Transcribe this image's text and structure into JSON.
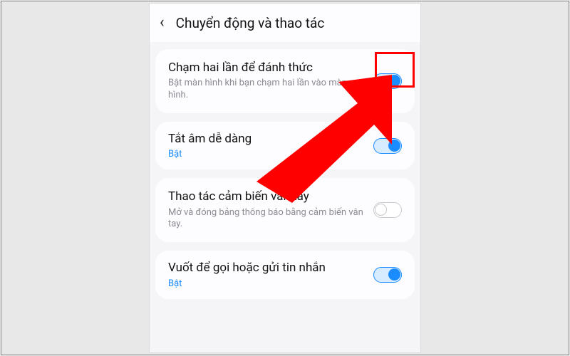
{
  "header": {
    "title": "Chuyển động và thao tác"
  },
  "items": [
    {
      "title": "Chạm hai lần để đánh thức",
      "desc": "Bật màn hình khi bạn chạm hai lần vào màn hình.",
      "on": true
    },
    {
      "title": "Tắt âm dễ dàng",
      "status": "Bật",
      "on": true
    },
    {
      "title": "Thao tác cảm biến vân tay",
      "desc": "Mở và đóng bảng thông báo bằng cảm biến vân tay.",
      "on": false
    },
    {
      "title": "Vuốt để gọi hoặc gửi tin nhắn",
      "status": "Bật",
      "on": true
    }
  ],
  "annotation": {
    "highlight_index": 0
  }
}
